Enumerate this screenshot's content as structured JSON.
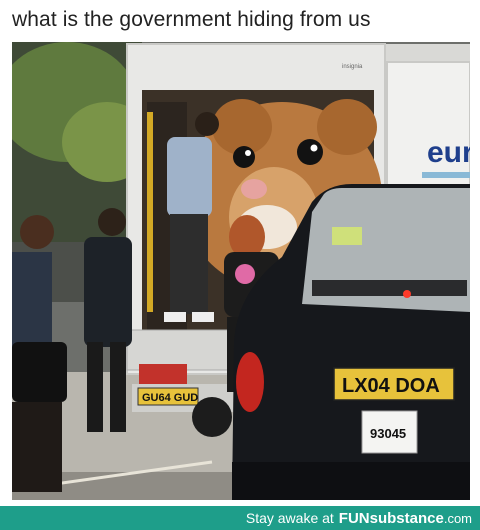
{
  "post": {
    "caption": "what is the government hiding from us"
  },
  "photo": {
    "truck_brand_text": "euro",
    "truck_small_text": "insignia",
    "truck_plate": "GU64 GUD",
    "taxi_plate": "LX04 DOA",
    "taxi_license": "93045",
    "colors": {
      "hamster_fur": "#b9793f",
      "taxi_body": "#16181c",
      "plate_yellow": "#e7c23b",
      "truck_white": "#e8e8e6"
    }
  },
  "footer": {
    "prefix": "Stay awake at",
    "brand": "FUNsubstance",
    "tld": ".com"
  }
}
